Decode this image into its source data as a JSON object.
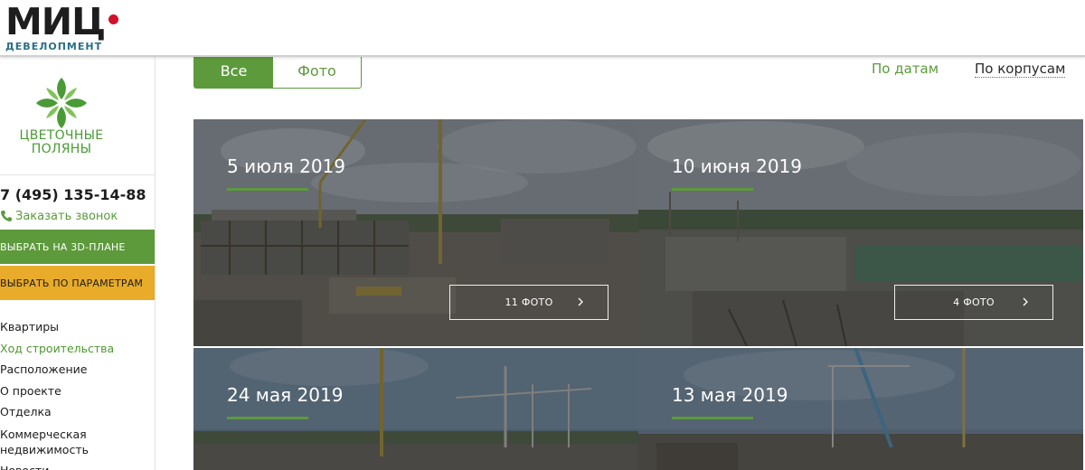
{
  "header": {
    "brand_name": "МИЦ",
    "brand_sub": "ДЕВЕЛОПМЕНТ",
    "brand_dot_color": "#d2102a"
  },
  "sidebar": {
    "logo_line1": "ЦВЕТОЧНЫЕ",
    "logo_line2": "ПОЛЯНЫ",
    "logo_icon": "flower-icon",
    "phone": "7 (495) 135-14-88",
    "callback_label": "Заказать звонок",
    "callback_icon": "phone-icon",
    "btn_3d_label": "ВЫБРАТЬ НА 3D-ПЛАНЕ",
    "btn_params_label": "ВЫБРАТЬ ПО ПАРАМЕТРАМ",
    "nav": [
      {
        "label": "Квартиры",
        "active": false
      },
      {
        "label": "Ход строительства",
        "active": true
      },
      {
        "label": "Расположение",
        "active": false
      },
      {
        "label": "О проекте",
        "active": false
      },
      {
        "label": "Отделка",
        "active": false
      },
      {
        "label": "Коммерческая недвижимость",
        "active": false
      },
      {
        "label": "Новости",
        "active": false
      }
    ]
  },
  "filter": {
    "all_label": "Все",
    "photo_label": "Фото"
  },
  "sort": {
    "by_date": "По датам",
    "by_corpus": "По корпусам"
  },
  "colors": {
    "accent_green": "#5d9a3c",
    "accent_orange": "#e8ab2a"
  },
  "gallery": [
    {
      "date": "5 июля 2019",
      "photos": "11 ФОТО"
    },
    {
      "date": "10 июня 2019",
      "photos": "4 ФОТО"
    },
    {
      "date": "24 мая 2019",
      "photos": ""
    },
    {
      "date": "13 мая 2019",
      "photos": ""
    }
  ]
}
